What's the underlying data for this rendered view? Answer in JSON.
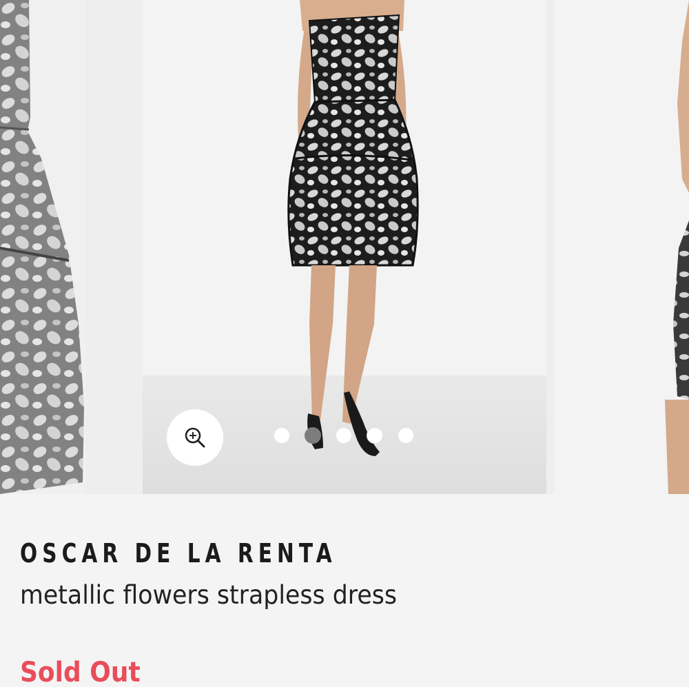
{
  "product": {
    "brand": "OSCAR DE LA RENTA",
    "name": "metallic flowers strapless dress",
    "availability": "Sold Out"
  },
  "gallery": {
    "image_count": 5,
    "active_index": 1,
    "zoom_icon": "zoom-in-icon"
  },
  "colors": {
    "sold_out": "#ea4d5a",
    "dot_active": "#7d7d7d",
    "dot_inactive": "#ffffff"
  }
}
